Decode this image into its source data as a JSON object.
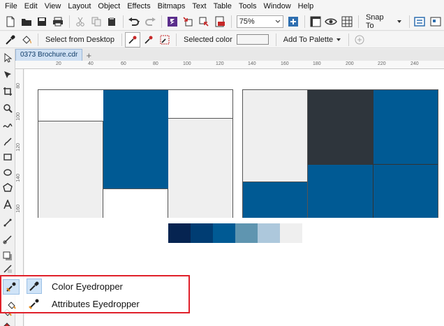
{
  "menu": [
    "File",
    "Edit",
    "View",
    "Layout",
    "Object",
    "Effects",
    "Bitmaps",
    "Text",
    "Table",
    "Tools",
    "Window",
    "Help"
  ],
  "toolbar": {
    "zoom_value": "75%",
    "snap_label": "Snap To"
  },
  "propbar": {
    "select_from_desktop": "Select from Desktop",
    "selected_color_label": "Selected color",
    "add_to_palette": "Add To Palette"
  },
  "document": {
    "tab_name": "0373 Brochure.cdr"
  },
  "ruler": {
    "h_ticks": [
      "20",
      "40",
      "60",
      "80",
      "100",
      "120",
      "140",
      "160",
      "180",
      "200",
      "220",
      "240"
    ],
    "v_ticks": [
      "80",
      "100",
      "120",
      "140",
      "160"
    ]
  },
  "colors": {
    "navy": "#005a94",
    "charcoal": "#2e353c",
    "light_gray": "#efefef",
    "palette": [
      "#062451",
      "#003d73",
      "#005a94",
      "#5f95b0",
      "#adc8dc",
      "#efefef"
    ]
  },
  "flyout": {
    "items": [
      {
        "label": "Color Eyedropper",
        "icon": "color-eyedropper-icon",
        "selected": true
      },
      {
        "label": "Attributes Eyedropper",
        "icon": "attributes-eyedropper-icon",
        "selected": false
      }
    ]
  }
}
